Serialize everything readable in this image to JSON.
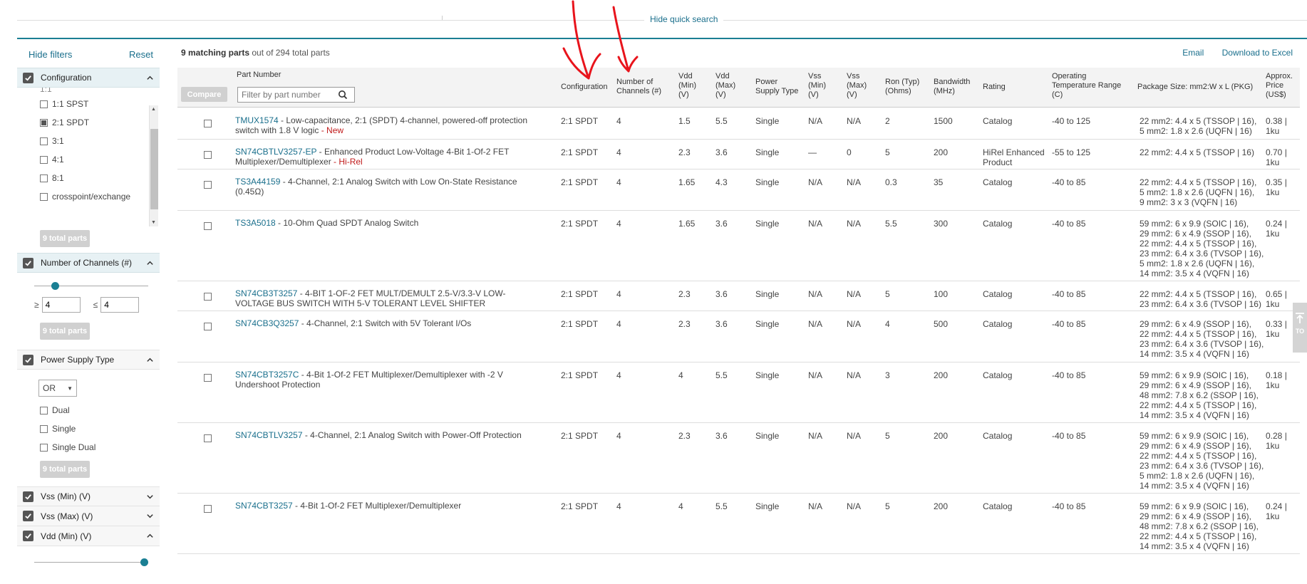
{
  "topbar": {
    "hide_quick_search": "Hide quick search"
  },
  "sidebar": {
    "hide_filters": "Hide filters",
    "reset": "Reset",
    "configuration": {
      "label": "Configuration",
      "cut_option": "1:1",
      "options": [
        {
          "label": "1:1 SPST",
          "checked": false
        },
        {
          "label": "2:1 SPDT",
          "checked": true
        },
        {
          "label": "3:1",
          "checked": false
        },
        {
          "label": "4:1",
          "checked": false
        },
        {
          "label": "8:1",
          "checked": false
        },
        {
          "label": "crosspoint/exchange",
          "checked": false
        }
      ],
      "total": "9 total parts"
    },
    "channels": {
      "label": "Number of Channels (#)",
      "ge": "≥",
      "le": "≤",
      "min": "4",
      "max": "4",
      "total": "9 total parts"
    },
    "power_supply": {
      "label": "Power Supply Type",
      "mode": "OR",
      "options": [
        "Dual",
        "Single",
        "Single Dual"
      ],
      "total": "9 total parts"
    },
    "vss_min": {
      "label": "Vss (Min) (V)"
    },
    "vss_max": {
      "label": "Vss (Max) (V)"
    },
    "vdd_min": {
      "label": "Vdd (Min) (V)"
    }
  },
  "main": {
    "summary_count": "9 matching parts",
    "summary_rest": "out of 294 total parts",
    "email": "Email",
    "download": "Download to Excel",
    "compare": "Compare",
    "filter_placeholder": "Filter by part number",
    "top_tab": "TO"
  },
  "headers": {
    "part_number": "Part Number",
    "configuration": "Configuration",
    "channels_1": "Number of",
    "channels_2": "Channels (#)",
    "vdd_min_1": "Vdd",
    "vdd_min_2": "(Min)",
    "vdd_min_3": "(V)",
    "vdd_max_1": "Vdd",
    "vdd_max_2": "(Max)",
    "vdd_max_3": "(V)",
    "power_1": "Power",
    "power_2": "Supply Type",
    "vss_min_1": "Vss",
    "vss_min_2": "(Min)",
    "vss_min_3": "(V)",
    "vss_max_1": "Vss",
    "vss_max_2": "(Max)",
    "vss_max_3": "(V)",
    "ron_1": "Ron (Typ)",
    "ron_2": "(Ohms)",
    "bw_1": "Bandwidth",
    "bw_2": "(MHz)",
    "rating": "Rating",
    "temp_1": "Operating",
    "temp_2": "Temperature Range",
    "temp_3": "(C)",
    "package": "Package Size: mm2:W x L (PKG)",
    "price_1": "Approx.",
    "price_2": "Price",
    "price_3": "(US$)"
  },
  "rows": [
    {
      "part": "TMUX1574",
      "desc": " - Low-capacitance, 2:1 (SPDT) 4-channel, powered-off protection switch with 1.8 V logic",
      "tag": " - New",
      "config": "2:1 SPDT",
      "channels": "4",
      "vdd_min": "1.5",
      "vdd_max": "5.5",
      "supply": "Single",
      "vss_min": "N/A",
      "vss_max": "N/A",
      "ron": "2",
      "bw": "1500",
      "rating": "Catalog",
      "temp": "-40 to 125",
      "pkg": [
        "22 mm2: 4.4 x 5 (TSSOP | 16),",
        "5 mm2: 1.8 x 2.6 (UQFN | 16)"
      ],
      "price": [
        "0.38 |",
        "1ku"
      ]
    },
    {
      "part": "SN74CBTLV3257-EP",
      "desc": " - Enhanced Product Low-Voltage 4-Bit 1-Of-2 FET Multiplexer/Demultiplexer",
      "tag": " - Hi-Rel",
      "config": "2:1 SPDT",
      "channels": "4",
      "vdd_min": "2.3",
      "vdd_max": "3.6",
      "supply": "Single",
      "vss_min": "—",
      "vss_max": "0",
      "ron": "5",
      "bw": "200",
      "rating": "HiRel Enhanced Product",
      "temp": "-55 to 125",
      "pkg": [
        "22 mm2: 4.4 x 5 (TSSOP | 16)"
      ],
      "price": [
        "0.70 |",
        "1ku"
      ]
    },
    {
      "part": "TS3A44159",
      "desc": " - 4-Channel, 2:1 Analog Switch with Low On-State Resistance (0.45Ω)",
      "tag": "",
      "config": "2:1 SPDT",
      "channels": "4",
      "vdd_min": "1.65",
      "vdd_max": "4.3",
      "supply": "Single",
      "vss_min": "N/A",
      "vss_max": "N/A",
      "ron": "0.3",
      "bw": "35",
      "rating": "Catalog",
      "temp": "-40 to 85",
      "pkg": [
        "22 mm2: 4.4 x 5 (TSSOP | 16),",
        "5 mm2: 1.8 x 2.6 (UQFN | 16),",
        "9 mm2: 3 x 3 (VQFN | 16)"
      ],
      "price": [
        "0.35 |",
        "1ku"
      ]
    },
    {
      "part": "TS3A5018",
      "desc": " - 10-Ohm Quad SPDT Analog Switch",
      "tag": "",
      "config": "2:1 SPDT",
      "channels": "4",
      "vdd_min": "1.65",
      "vdd_max": "3.6",
      "supply": "Single",
      "vss_min": "N/A",
      "vss_max": "N/A",
      "ron": "5.5",
      "bw": "300",
      "rating": "Catalog",
      "temp": "-40 to 85",
      "pkg": [
        "59 mm2: 6 x 9.9 (SOIC | 16),",
        "29 mm2: 6 x 4.9 (SSOP | 16),",
        "22 mm2: 4.4 x 5 (TSSOP | 16),",
        "23 mm2: 6.4 x 3.6 (TVSOP | 16),",
        "5 mm2: 1.8 x 2.6 (UQFN | 16),",
        "14 mm2: 3.5 x 4 (VQFN | 16)"
      ],
      "price": [
        "0.24 |",
        "1ku"
      ]
    },
    {
      "part": "SN74CB3T3257",
      "desc": " - 4-BIT 1-OF-2 FET MULT/DEMULT 2.5-V/3.3-V LOW-VOLTAGE BUS SWITCH WITH 5-V TOLERANT LEVEL SHIFTER",
      "tag": "",
      "config": "2:1 SPDT",
      "channels": "4",
      "vdd_min": "2.3",
      "vdd_max": "3.6",
      "supply": "Single",
      "vss_min": "N/A",
      "vss_max": "N/A",
      "ron": "5",
      "bw": "100",
      "rating": "Catalog",
      "temp": "-40 to 85",
      "pkg": [
        "22 mm2: 4.4 x 5 (TSSOP | 16),",
        "23 mm2: 6.4 x 3.6 (TVSOP | 16)"
      ],
      "price": [
        "0.65 |",
        "1ku"
      ]
    },
    {
      "part": "SN74CB3Q3257",
      "desc": " - 4-Channel, 2:1 Switch with 5V Tolerant I/Os",
      "tag": "",
      "config": "2:1 SPDT",
      "channels": "4",
      "vdd_min": "2.3",
      "vdd_max": "3.6",
      "supply": "Single",
      "vss_min": "N/A",
      "vss_max": "N/A",
      "ron": "4",
      "bw": "500",
      "rating": "Catalog",
      "temp": "-40 to 85",
      "pkg": [
        "29 mm2: 6 x 4.9 (SSOP | 16),",
        "22 mm2: 4.4 x 5 (TSSOP | 16),",
        "23 mm2: 6.4 x 3.6 (TVSOP | 16),",
        "14 mm2: 3.5 x 4 (VQFN | 16)"
      ],
      "price": [
        "0.33 |",
        "1ku"
      ]
    },
    {
      "part": "SN74CBT3257C",
      "desc": " - 4-Bit 1-Of-2 FET Multiplexer/Demultiplexer with -2 V Undershoot Protection",
      "tag": "",
      "config": "2:1 SPDT",
      "channels": "4",
      "vdd_min": "4",
      "vdd_max": "5.5",
      "supply": "Single",
      "vss_min": "N/A",
      "vss_max": "N/A",
      "ron": "3",
      "bw": "200",
      "rating": "Catalog",
      "temp": "-40 to 85",
      "pkg": [
        "59 mm2: 6 x 9.9 (SOIC | 16),",
        "29 mm2: 6 x 4.9 (SSOP | 16),",
        "48 mm2: 7.8 x 6.2 (SSOP | 16),",
        "22 mm2: 4.4 x 5 (TSSOP | 16),",
        "14 mm2: 3.5 x 4 (VQFN | 16)"
      ],
      "price": [
        "0.18 |",
        "1ku"
      ]
    },
    {
      "part": "SN74CBTLV3257",
      "desc": " - 4-Channel, 2:1 Analog Switch with Power-Off Protection",
      "tag": "",
      "config": "2:1 SPDT",
      "channels": "4",
      "vdd_min": "2.3",
      "vdd_max": "3.6",
      "supply": "Single",
      "vss_min": "N/A",
      "vss_max": "N/A",
      "ron": "5",
      "bw": "200",
      "rating": "Catalog",
      "temp": "-40 to 85",
      "pkg": [
        "59 mm2: 6 x 9.9 (SOIC | 16),",
        "29 mm2: 6 x 4.9 (SSOP | 16),",
        "22 mm2: 4.4 x 5 (TSSOP | 16),",
        "23 mm2: 6.4 x 3.6 (TVSOP | 16),",
        "5 mm2: 1.8 x 2.6 (UQFN | 16),",
        "14 mm2: 3.5 x 4 (VQFN | 16)"
      ],
      "price": [
        "0.28 |",
        "1ku"
      ]
    },
    {
      "part": "SN74CBT3257",
      "desc": " - 4-Bit 1-Of-2 FET Multiplexer/Demultiplexer",
      "tag": "",
      "config": "2:1 SPDT",
      "channels": "4",
      "vdd_min": "4",
      "vdd_max": "5.5",
      "supply": "Single",
      "vss_min": "N/A",
      "vss_max": "N/A",
      "ron": "5",
      "bw": "200",
      "rating": "Catalog",
      "temp": "-40 to 85",
      "pkg": [
        "59 mm2: 6 x 9.9 (SOIC | 16),",
        "29 mm2: 6 x 4.9 (SSOP | 16),",
        "48 mm2: 7.8 x 6.2 (SSOP | 16),",
        "22 mm2: 4.4 x 5 (TSSOP | 16),",
        "14 mm2: 3.5 x 4 (VQFN | 16)"
      ],
      "price": [
        "0.24 |",
        "1ku"
      ]
    }
  ],
  "icons": {
    "search": "search-icon",
    "checkbox": "checkmark-icon",
    "chevron_up": "chevron-up-icon",
    "chevron_down": "chevron-down-icon",
    "scroll_top": "arrow-up-icon"
  },
  "colors": {
    "link": "#1a6f8c",
    "accent": "#1a7f93",
    "tag": "#c01a1a",
    "annotation": "#e8141c"
  }
}
